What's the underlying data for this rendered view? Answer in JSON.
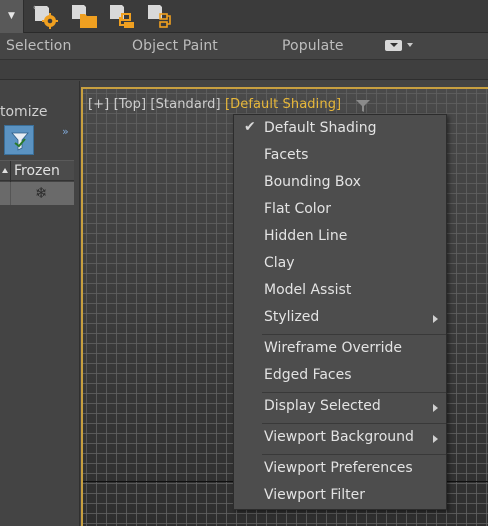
{
  "ribbon": {
    "tabs": [
      "Selection",
      "Object Paint",
      "Populate"
    ]
  },
  "left_panel": {
    "title_fragment": "tomize",
    "column_header": "Frozen",
    "row_icon": "❄"
  },
  "viewport": {
    "label_plus": "[+]",
    "label_view": "[Top]",
    "label_mode": "[Standard]",
    "label_shading": "[Default Shading]"
  },
  "menu": {
    "items": [
      {
        "label": "Default Shading",
        "checked": true,
        "submenu": false
      },
      {
        "label": "Facets",
        "checked": false,
        "submenu": false
      },
      {
        "label": "Bounding Box",
        "checked": false,
        "submenu": false
      },
      {
        "label": "Flat Color",
        "checked": false,
        "submenu": false
      },
      {
        "label": "Hidden Line",
        "checked": false,
        "submenu": false
      },
      {
        "label": "Clay",
        "checked": false,
        "submenu": false
      },
      {
        "label": "Model Assist",
        "checked": false,
        "submenu": false
      },
      {
        "label": "Stylized",
        "checked": false,
        "submenu": true
      },
      {
        "label": "Wireframe Override",
        "checked": false,
        "submenu": false
      },
      {
        "label": "Edged Faces",
        "checked": false,
        "submenu": false
      },
      {
        "label": "Display Selected",
        "checked": false,
        "submenu": true
      },
      {
        "label": "Viewport Background",
        "checked": false,
        "submenu": true
      },
      {
        "label": "Viewport Preferences",
        "checked": false,
        "submenu": false
      },
      {
        "label": "Viewport Filter",
        "checked": false,
        "submenu": false
      }
    ]
  },
  "icons": {
    "toolbar": [
      "toolbar-dropdown-icon",
      "scene-settings-icon",
      "folder-scene-icon",
      "scene-hierarchy-icon",
      "scene-link-icon"
    ],
    "menu_check": "✔"
  },
  "colors": {
    "viewport_border": "#c8a040",
    "shading_label": "#e8b83a",
    "filter_button": "#5b93c2"
  }
}
